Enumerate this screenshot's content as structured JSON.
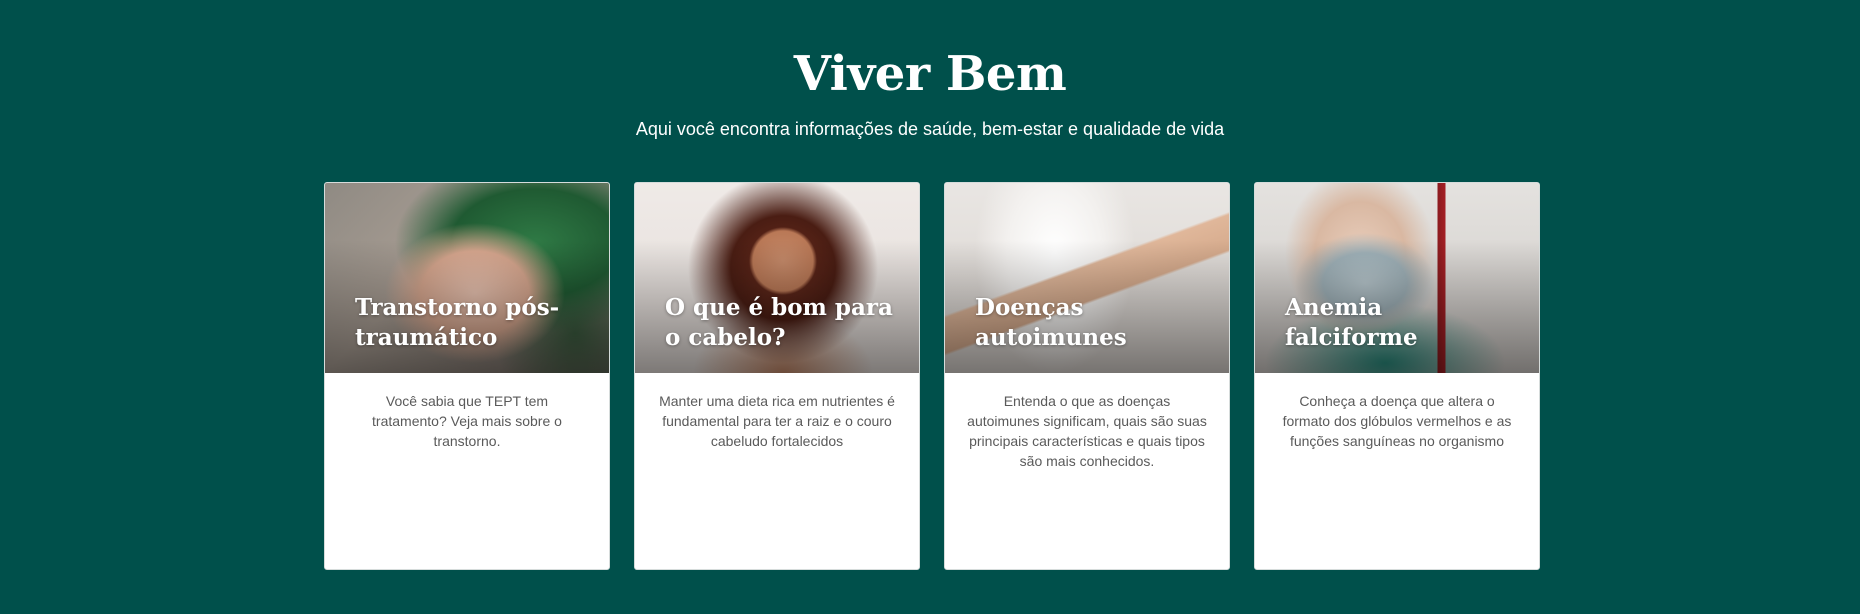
{
  "section": {
    "title": "Viver Bem",
    "subtitle": "Aqui você encontra informações de saúde, bem-estar e qualidade de vida"
  },
  "cards": [
    {
      "title": "Transtorno pós-traumático",
      "description": "Você sabia que TEPT tem tratamento? Veja mais sobre o transtorno."
    },
    {
      "title": "O que é bom para o cabelo?",
      "description": "Manter uma dieta rica em nutrientes é fundamental para ter a raiz e o couro cabeludo fortalecidos"
    },
    {
      "title": "Doenças autoimunes",
      "description": "Entenda o que as doenças autoimunes significam, quais são suas principais características e quais tipos são mais conhecidos."
    },
    {
      "title": "Anemia falciforme",
      "description": "Conheça a doença que altera o formato dos glóbulos vermelhos e as funções sanguíneas no organismo"
    }
  ],
  "colors": {
    "background": "#00504b",
    "card_background": "#ffffff",
    "title_text": "#ffffff",
    "description_text": "#5a5a5a"
  }
}
